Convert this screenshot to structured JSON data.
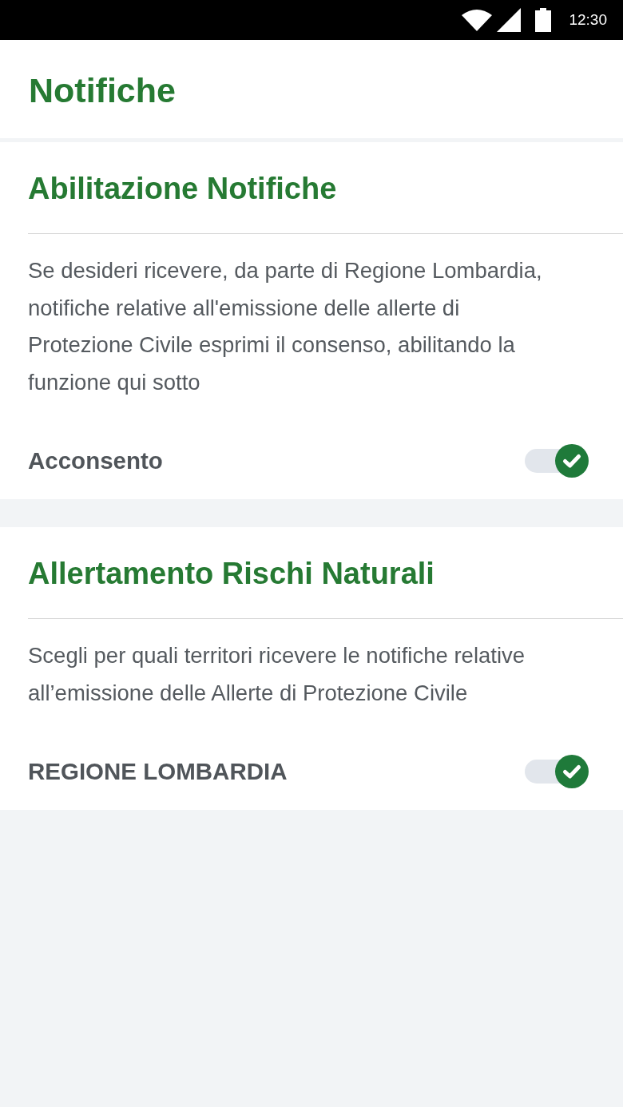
{
  "status_bar": {
    "time": "12:30"
  },
  "header": {
    "title": "Notifiche"
  },
  "sections": [
    {
      "title": "Abilitazione Notifiche",
      "description": "Se desideri ricevere, da parte di Regione Lombardia, notifiche relative all'emissione delle allerte di Protezione Civile esprimi il consenso, abilitando la funzione qui sotto",
      "toggle": {
        "label": "Acconsento",
        "on": true
      }
    },
    {
      "title": "Allertamento Rischi Naturali",
      "description": "Scegli per quali territori ricevere le notifiche relative all’emissione delle Allerte di Protezione Civile",
      "toggle": {
        "label": "REGIONE LOMBARDIA",
        "on": true
      }
    }
  ]
}
